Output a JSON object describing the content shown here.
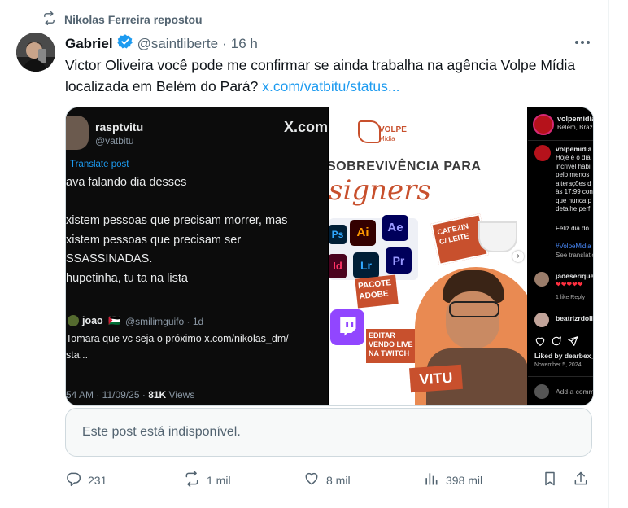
{
  "repost": {
    "text": "Nikolas Ferreira repostou",
    "icon": "repost-icon"
  },
  "author": {
    "name": "Gabriel",
    "handle": "@saintliberte",
    "separator": "·",
    "time": "16 h",
    "verified_color": "#1d9bf0"
  },
  "post": {
    "text": "Victor Oliveira você pode me confirmar se ainda trabalha na agência Volpe Mídia localizada em Belém do Pará?",
    "link": "x.com/vatbitu/status..."
  },
  "media": {
    "panel1": {
      "name": "rasptvitu",
      "handle": "@vatbitu",
      "brand": "X.com",
      "translate": "Translate post",
      "lines": [
        "ava falando dia desses",
        "xistem pessoas que precisam morrer, mas",
        "xistem pessoas que precisam ser",
        "SSASSINADAS.",
        "hupetinha, tu ta na lista"
      ],
      "reply_name": "joao",
      "reply_handle": "@smilimguifo · 1d",
      "reply_text_1": "Tomara que vc seja o próximo x.com/nikolas_dm/",
      "reply_text_2": "sta...",
      "time": "54 AM · 11/09/25 ·",
      "views_count": "81K",
      "views_label": "Views"
    },
    "panel2": {
      "logo_1": "VOLPE",
      "logo_2": "Mídia",
      "headline": "SOBREVIVÊNCIA PARA",
      "script": "signers",
      "app_icons": [
        "Ps",
        "Ai",
        "Ae",
        "Id",
        "Lr",
        "Pr"
      ],
      "tag_coffee": "CAFEZIN C/ LEITE",
      "tag_adobe": "PACOTE ADOBE",
      "tag_twitch": "EDITAR VENDO LIVE NA TWITCH",
      "tag_name": "VITU"
    },
    "panel3": {
      "account": "volpemidia",
      "location": "Belém, Brazil",
      "caption_lines": [
        "Hoje é o dia",
        "incrível habi",
        "pelo menos",
        "alterações d",
        "às 17:99 con",
        "que nunca p",
        "detalhe perf"
      ],
      "feliz": "Feliz dia do",
      "hashtag": "#VolpeMidia",
      "see_translation": "See translatio",
      "comment1_user": "jadeserique",
      "comment1_meta": "1 like  Reply",
      "comment2_user": "beatrizrdoli",
      "liked_by": "Liked by dearbex_",
      "date": "November 5, 2024",
      "add_comment": "Add a comm"
    }
  },
  "unavailable": "Este post está indisponível.",
  "actions": {
    "replies": "231",
    "reposts": "1 mil",
    "likes": "8 mil",
    "views": "398 mil"
  },
  "colors": {
    "accent": "#1d9bf0",
    "muted": "#536471",
    "text": "#0f1419",
    "volpe": "#c8502d"
  }
}
